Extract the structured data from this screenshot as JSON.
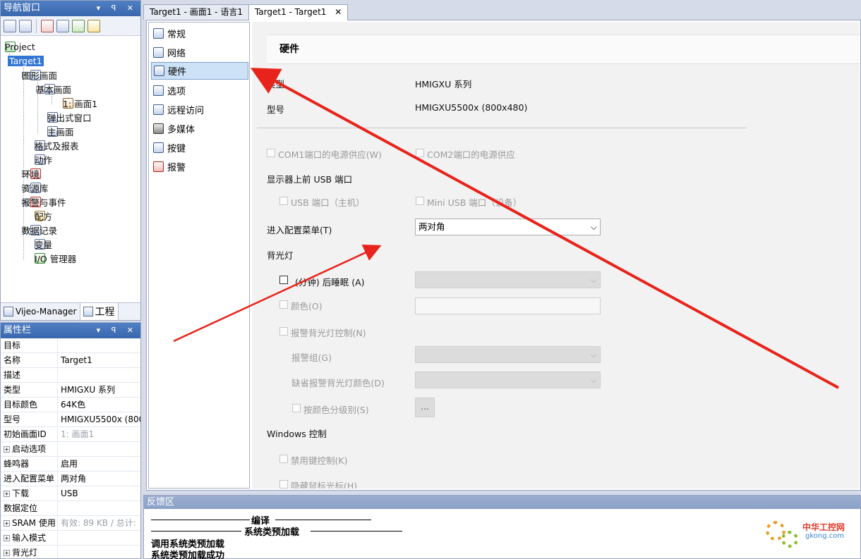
{
  "nav_panel": {
    "title": "导航窗口",
    "controls": "▾ ꟼ ✕",
    "tree": {
      "project": "Project",
      "target": "Target1",
      "graphics": "图形画面",
      "base_screens": "基本画面",
      "screen1": "1: 画面1",
      "popup": "弹出式窗口",
      "main_screen": "主画面",
      "format_report": "格式及报表",
      "action": "动作",
      "environment": "环境",
      "resources": "资源库",
      "alarm_events": "报警与事件",
      "recipe": "配方",
      "data_log": "数据记录",
      "variables": "变量",
      "io_manager": "I/O 管理器"
    },
    "tabs": [
      "Vijeo-Manager",
      "工程"
    ]
  },
  "properties_panel": {
    "title": "属性栏",
    "controls": "▾ ꟼ ✕",
    "rows": [
      {
        "key": "目标",
        "value": ""
      },
      {
        "key": "名称",
        "value": "Target1"
      },
      {
        "key": "描述",
        "value": ""
      },
      {
        "key": "类型",
        "value": "HMIGXU 系列"
      },
      {
        "key": "目标颜色",
        "value": "64K色"
      },
      {
        "key": "型号",
        "value": "HMIGXU5500x (800"
      },
      {
        "key": "初始画面ID",
        "value": "1: 画面1"
      },
      {
        "key": "启动选项",
        "value": ""
      },
      {
        "key": "蜂鸣器",
        "value": "启用"
      },
      {
        "key": "进入配置菜单",
        "value": "两对角"
      },
      {
        "key": "下载",
        "value": "USB"
      },
      {
        "key": "数据定位",
        "value": ""
      },
      {
        "key": "SRAM 使用",
        "value": "有效: 89 KB / 总计:"
      },
      {
        "key": "输入模式",
        "value": ""
      },
      {
        "key": "背光灯",
        "value": ""
      }
    ]
  },
  "doc_tabs": [
    {
      "label": "Target1 - 画面1 - 语言1"
    },
    {
      "label": "Target1 - Target1",
      "close": "✕"
    }
  ],
  "categories": [
    "常规",
    "网络",
    "硬件",
    "选项",
    "远程访问",
    "多媒体",
    "按键",
    "报警"
  ],
  "hardware": {
    "header": "硬件",
    "type_label": "类型",
    "type_value": "HMIGXU 系列",
    "model_label": "型号",
    "model_value": "HMIGXU5500x (800x480)",
    "com1_power": "COM1端口的电源供应(W)",
    "com2_power": "COM2端口的电源供应",
    "front_usb": "显示器上前 USB 端口",
    "usb_host": "USB 端口（主机）",
    "mini_usb": "Mini USB 端口（设备）",
    "config_menu_label": "进入配置菜单(T)",
    "config_menu_value": "两对角",
    "backlight": "背光灯",
    "sleep_after": "(分钟) 后睡眠 (A)",
    "color": "颜色(O)",
    "alarm_backlight": "报警背光灯控制(N)",
    "alarm_group": "报警组(G)",
    "default_alarm_color": "缺省报警背光灯颜色(D)",
    "color_by_level": "按颜色分级别(S)",
    "ellipsis": "...",
    "windows_control": "Windows 控制",
    "disable_keys": "禁用键控制(K)",
    "hide_cursor": "隐藏鼠标光标(H)"
  },
  "feedback": {
    "title": "反馈区",
    "lines": [
      "编译",
      "系统类预加载",
      "调用系统类预加载",
      "系统类预加载成功"
    ]
  },
  "watermark": {
    "cn": "中华工控网",
    "url": "gkong.com"
  },
  "colors": {
    "title_bar": "#3a67ad",
    "selection": "#3376d6",
    "arrow": "#e8231b"
  }
}
